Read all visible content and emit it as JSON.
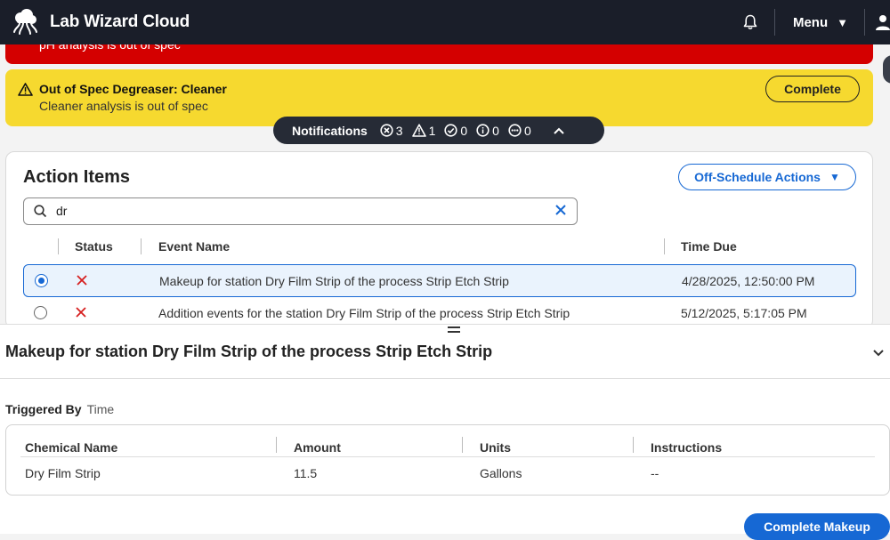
{
  "app": {
    "title": "Lab Wizard Cloud",
    "logo_icon": "microscope-cloud-icon"
  },
  "topbar": {
    "menu_label": "Menu",
    "menu_caret": "▼"
  },
  "alerts": {
    "red": {
      "message": "pH analysis is out of spec",
      "color": "#d40000"
    },
    "yellow": {
      "title": "Out of Spec Degreaser: Cleaner",
      "message": "Cleaner analysis is out of spec",
      "button": "Complete",
      "color": "#f6d92f"
    }
  },
  "notifications": {
    "label": "Notifications",
    "counts": {
      "error": "3",
      "warning": "1",
      "success": "0",
      "info": "0",
      "other": "0"
    }
  },
  "action_items": {
    "title": "Action Items",
    "off_schedule_label": "Off-Schedule Actions",
    "off_schedule_caret": "▼",
    "search_value": "dr",
    "columns": {
      "status": "Status",
      "event": "Event Name",
      "due": "Time Due"
    },
    "rows": [
      {
        "selected": true,
        "status": "failed",
        "event": "Makeup for station Dry Film Strip of the process Strip Etch Strip",
        "due": "4/28/2025, 12:50:00 PM"
      },
      {
        "selected": false,
        "status": "failed",
        "event": "Addition events for the station Dry Film Strip of the process Strip Etch Strip",
        "due": "5/12/2025, 5:17:05 PM"
      }
    ]
  },
  "detail": {
    "title": "Makeup for station Dry Film Strip of the process Strip Etch Strip",
    "triggered_by_label": "Triggered By",
    "triggered_by_value": "Time",
    "columns": {
      "chemical": "Chemical Name",
      "amount": "Amount",
      "units": "Units",
      "instructions": "Instructions"
    },
    "rows": [
      {
        "chemical": "Dry Film Strip",
        "amount": "11.5",
        "units": "Gallons",
        "instructions": "--"
      }
    ],
    "complete_button": "Complete Makeup"
  },
  "colors": {
    "topbar": "#1a1e29",
    "accent": "#1668d4",
    "status_x": "#d61f1f"
  }
}
